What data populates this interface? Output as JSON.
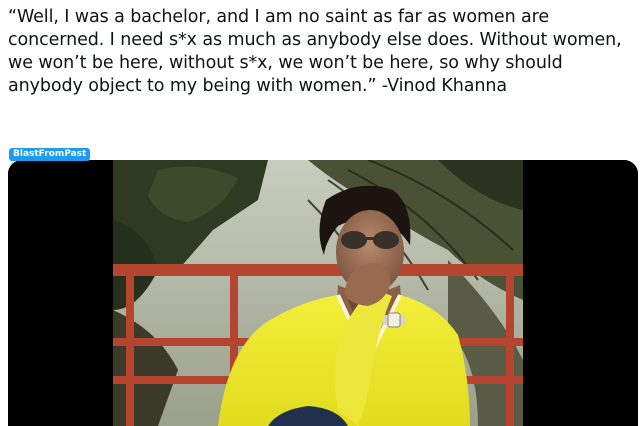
{
  "tweet": {
    "text": "“Well, I was a bachelor, and I am no saint as far as women are concerned. I need s*x as much as anybody else does. Without women, we won’t be here, without s*x, we won’t be here, so why should anybody object to my being with women.” -Vinod Khanna"
  },
  "media": {
    "tag": "BlastFromPast",
    "tag_color": "#1d9bf0",
    "kind": "video"
  }
}
